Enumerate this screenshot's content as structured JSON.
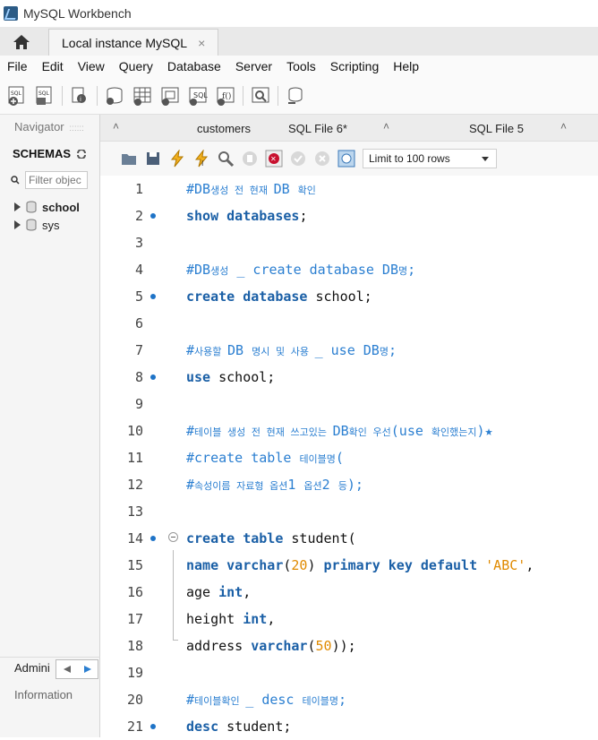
{
  "window": {
    "title": "MySQL Workbench"
  },
  "tabs": {
    "connection": "Local instance MySQL",
    "close": "×"
  },
  "menu": [
    "File",
    "Edit",
    "View",
    "Query",
    "Database",
    "Server",
    "Tools",
    "Scripting",
    "Help"
  ],
  "navigator": {
    "header": "Navigator",
    "schemas_label": "SCHEMAS",
    "filter_placeholder": "Filter objec",
    "schemas": [
      {
        "name": "school",
        "bold": true
      },
      {
        "name": "sys",
        "bold": false
      }
    ],
    "admin_label": "Admini",
    "info_label": "Information"
  },
  "editor_tabs": [
    {
      "label": "customers"
    },
    {
      "label": "SQL File 6*"
    },
    {
      "label": "SQL File 5"
    }
  ],
  "editor_toolbar": {
    "limit_label": "Limit to 100 rows"
  },
  "code_lines": [
    {
      "n": "1",
      "dot": false,
      "parts": [
        [
          "cm",
          "#DB"
        ],
        [
          "cm-ko",
          "생성 전 현재 "
        ],
        [
          "cm",
          "DB "
        ],
        [
          "cm-ko",
          "확인"
        ]
      ]
    },
    {
      "n": "2",
      "dot": true,
      "parts": [
        [
          "kw",
          "show databases"
        ],
        [
          "plain",
          ";"
        ]
      ]
    },
    {
      "n": "3",
      "dot": false,
      "parts": []
    },
    {
      "n": "4",
      "dot": false,
      "parts": [
        [
          "cm",
          "#DB"
        ],
        [
          "cm-ko",
          "생성"
        ],
        [
          "cm",
          " _ create database DB"
        ],
        [
          "cm-ko",
          "명"
        ],
        [
          "cm",
          ";"
        ]
      ]
    },
    {
      "n": "5",
      "dot": true,
      "parts": [
        [
          "kw",
          "create database "
        ],
        [
          "plain",
          "school;"
        ]
      ]
    },
    {
      "n": "6",
      "dot": false,
      "parts": []
    },
    {
      "n": "7",
      "dot": false,
      "parts": [
        [
          "cm",
          "#"
        ],
        [
          "cm-ko",
          "사용할 "
        ],
        [
          "cm",
          "DB "
        ],
        [
          "cm-ko",
          "명시 및 사용 "
        ],
        [
          "cm",
          "_ use DB"
        ],
        [
          "cm-ko",
          "명"
        ],
        [
          "cm",
          ";"
        ]
      ]
    },
    {
      "n": "8",
      "dot": true,
      "parts": [
        [
          "kw",
          "use "
        ],
        [
          "plain",
          "school;"
        ]
      ]
    },
    {
      "n": "9",
      "dot": false,
      "parts": []
    },
    {
      "n": "10",
      "dot": false,
      "parts": [
        [
          "cm",
          "#"
        ],
        [
          "cm-ko",
          "테이블 생성 전 현재 쓰고있는 "
        ],
        [
          "cm",
          "DB"
        ],
        [
          "cm-ko",
          "확인 우선"
        ],
        [
          "cm",
          "(use "
        ],
        [
          "cm-ko",
          "확인했는지"
        ],
        [
          "cm",
          ")★"
        ]
      ]
    },
    {
      "n": "11",
      "dot": false,
      "parts": [
        [
          "cm",
          "#create table "
        ],
        [
          "cm-ko",
          "테이블명"
        ],
        [
          "cm",
          "("
        ]
      ]
    },
    {
      "n": "12",
      "dot": false,
      "parts": [
        [
          "cm",
          "#"
        ],
        [
          "cm-ko",
          "속성이름 자료형 옵션"
        ],
        [
          "cm",
          "1 "
        ],
        [
          "cm-ko",
          "옵션"
        ],
        [
          "cm",
          "2 "
        ],
        [
          "cm-ko",
          "등"
        ],
        [
          "cm",
          ");"
        ]
      ]
    },
    {
      "n": "13",
      "dot": false,
      "parts": []
    },
    {
      "n": "14",
      "dot": true,
      "fold": true,
      "parts": [
        [
          "kw",
          "create table "
        ],
        [
          "plain",
          "student("
        ]
      ]
    },
    {
      "n": "15",
      "dot": false,
      "parts": [
        [
          "kw",
          "name varchar"
        ],
        [
          "plain",
          "("
        ],
        [
          "num",
          "20"
        ],
        [
          "plain",
          ") "
        ],
        [
          "kw",
          "primary key default "
        ],
        [
          "str",
          "'ABC'"
        ],
        [
          "plain",
          ","
        ]
      ]
    },
    {
      "n": "16",
      "dot": false,
      "parts": [
        [
          "plain",
          "age "
        ],
        [
          "kw",
          "int"
        ],
        [
          "plain",
          ","
        ]
      ]
    },
    {
      "n": "17",
      "dot": false,
      "parts": [
        [
          "plain",
          "height "
        ],
        [
          "kw",
          "int"
        ],
        [
          "plain",
          ","
        ]
      ]
    },
    {
      "n": "18",
      "dot": false,
      "parts": [
        [
          "plain",
          "address "
        ],
        [
          "kw",
          "varchar"
        ],
        [
          "plain",
          "("
        ],
        [
          "num",
          "50"
        ],
        [
          "plain",
          "));"
        ]
      ]
    },
    {
      "n": "19",
      "dot": false,
      "parts": []
    },
    {
      "n": "20",
      "dot": false,
      "parts": [
        [
          "cm",
          "#"
        ],
        [
          "cm-ko",
          "테이블확인 "
        ],
        [
          "cm",
          "_ desc "
        ],
        [
          "cm-ko",
          "테이블명"
        ],
        [
          "cm",
          ";"
        ]
      ]
    },
    {
      "n": "21",
      "dot": true,
      "parts": [
        [
          "kw",
          "desc "
        ],
        [
          "plain",
          "student;"
        ]
      ]
    }
  ]
}
